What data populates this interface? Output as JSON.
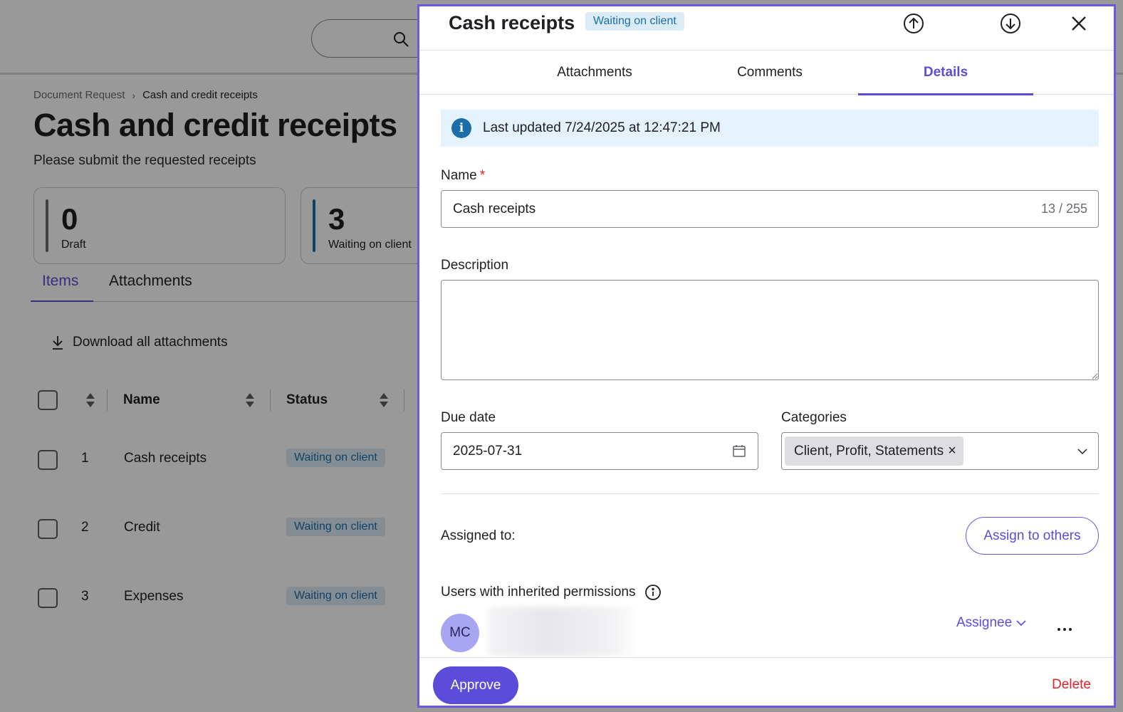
{
  "background": {
    "breadcrumb": {
      "parent": "Document Request",
      "current": "Cash and credit receipts"
    },
    "title": "Cash and credit receipts",
    "subtitle": "Please submit the requested receipts",
    "stats": [
      {
        "value": "0",
        "label": "Draft",
        "color": "#6b6b73"
      },
      {
        "value": "3",
        "label": "Waiting on client",
        "color": "#1b6ea8"
      }
    ],
    "tabs": [
      "Items",
      "Attachments"
    ],
    "download_all": "Download all attachments",
    "table": {
      "columns": [
        "Name",
        "Status"
      ],
      "rows": [
        {
          "index": "1",
          "name": "Cash receipts",
          "status": "Waiting on client"
        },
        {
          "index": "2",
          "name": "Credit",
          "status": "Waiting on client"
        },
        {
          "index": "3",
          "name": "Expenses",
          "status": "Waiting on client"
        }
      ]
    }
  },
  "panel": {
    "title": "Cash receipts",
    "status": "Waiting on client",
    "icons": {
      "prev": "arrow-up-circle-icon",
      "next": "arrow-down-circle-icon",
      "close": "close-icon"
    },
    "tabs": [
      "Attachments",
      "Comments",
      "Details"
    ],
    "active_tab": "Details",
    "info": "Last updated 7/24/2025 at 12:47:21 PM",
    "name_label": "Name",
    "required_mark": "*",
    "name_value": "Cash receipts",
    "name_count": "13 / 255",
    "description_label": "Description",
    "description_value": "",
    "due_date_label": "Due date",
    "due_date_value": "2025-07-31",
    "categories_label": "Categories",
    "categories_chip": "Client, Profit, Statements",
    "chip_remove": "×",
    "assigned_label": "Assigned to:",
    "assign_button": "Assign to others",
    "inherited_label": "Users with inherited permissions",
    "user": {
      "initials": "MC",
      "role": "Assignee"
    },
    "approve_button": "Approve",
    "delete_button": "Delete",
    "colors": {
      "accent": "#5b4dd9",
      "danger": "#d9252b",
      "info_bg": "#e4f2fb",
      "badge_text": "#1b6ea8"
    }
  }
}
